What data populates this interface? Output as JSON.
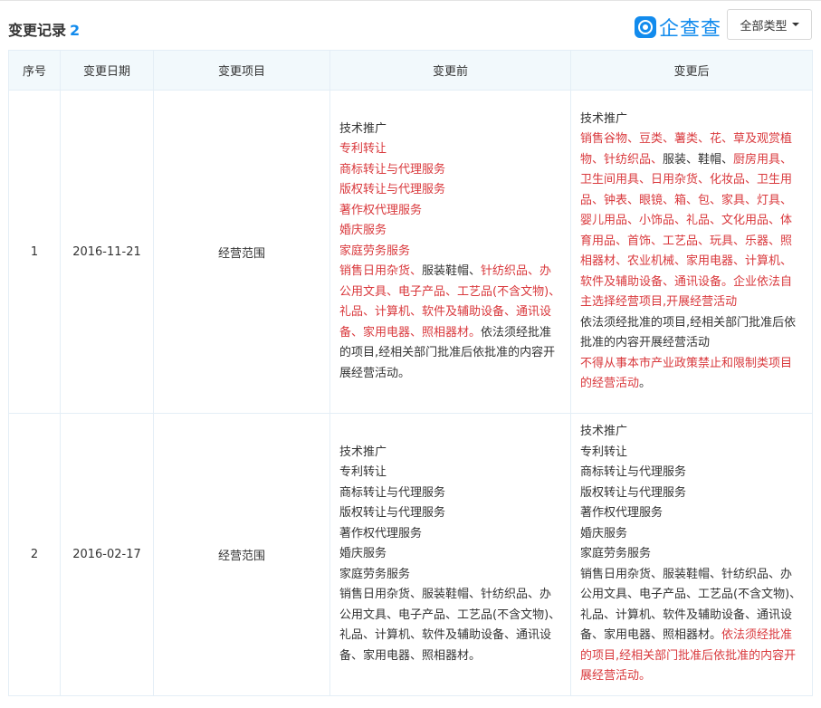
{
  "header": {
    "title": "变更记录",
    "count": "2",
    "logo_text": "企查查",
    "logo_icon": "qichacha-logo-icon",
    "filter_label": "全部类型",
    "filter_icon": "caret-down-icon"
  },
  "columns": [
    "序号",
    "变更日期",
    "变更项目",
    "变更前",
    "变更后"
  ],
  "colors": {
    "accent": "#128bed",
    "changed_text": "#d9383c",
    "header_bg": "#f2f9fc"
  },
  "rows": [
    {
      "index": "1",
      "date": "2016-11-21",
      "item": "经营范围",
      "before": [
        {
          "t": "技术推广",
          "hl": false,
          "br": true
        },
        {
          "t": "专利转让",
          "hl": true,
          "br": true
        },
        {
          "t": "商标转让与代理服务",
          "hl": true,
          "br": true
        },
        {
          "t": "版权转让与代理服务",
          "hl": true,
          "br": true
        },
        {
          "t": "著作权代理服务",
          "hl": true,
          "br": true
        },
        {
          "t": "婚庆服务",
          "hl": true,
          "br": true
        },
        {
          "t": "家庭劳务服务",
          "hl": true,
          "br": true
        },
        {
          "t": "销售日用杂货、",
          "hl": true,
          "br": false
        },
        {
          "t": "服装鞋帽、",
          "hl": false,
          "br": false
        },
        {
          "t": "针纺织品、办公用文具、电子产品、工艺品(不含文物)、礼品、计算机、软件及辅助设备、通讯设备、家用电器、照相器材。",
          "hl": true,
          "br": false
        },
        {
          "t": "依法须经批准的项目,经相关部门批准后依批准的内容开展经营活动。",
          "hl": false,
          "br": false
        }
      ],
      "after": [
        {
          "t": "技术推广",
          "hl": false,
          "br": true
        },
        {
          "t": "销售谷物、豆类、薯类、花、草及观赏植物、针纺织品、",
          "hl": true,
          "br": false
        },
        {
          "t": "服装、鞋帽、",
          "hl": false,
          "br": false
        },
        {
          "t": "厨房用具、卫生间用具、日用杂货、化妆品、卫生用品、钟表、眼镜、箱、包、家具、灯具、婴儿用品、小饰品、礼品、文化用品、体育用品、首饰、工艺品、玩具、乐器、照相器材、农业机械、家用电器、计算机、软件及辅助设备、通讯设备。企业依法自主选择经营项目,开展经营活动",
          "hl": true,
          "br": true
        },
        {
          "t": "依法须经批准的项目,经相关部门批准后依批准的内容开展经营活动",
          "hl": false,
          "br": true
        },
        {
          "t": "不得从事本市产业政策禁止和限制类项目的经营活动",
          "hl": true,
          "br": false
        },
        {
          "t": "。",
          "hl": false,
          "br": false
        }
      ]
    },
    {
      "index": "2",
      "date": "2016-02-17",
      "item": "经营范围",
      "before": [
        {
          "t": "技术推广",
          "hl": false,
          "br": true
        },
        {
          "t": "专利转让",
          "hl": false,
          "br": true
        },
        {
          "t": "商标转让与代理服务",
          "hl": false,
          "br": true
        },
        {
          "t": "版权转让与代理服务",
          "hl": false,
          "br": true
        },
        {
          "t": "著作权代理服务",
          "hl": false,
          "br": true
        },
        {
          "t": "婚庆服务",
          "hl": false,
          "br": true
        },
        {
          "t": "家庭劳务服务",
          "hl": false,
          "br": true
        },
        {
          "t": "销售日用杂货、服装鞋帽、针纺织品、办公用文具、电子产品、工艺品(不含文物)、礼品、计算机、软件及辅助设备、通讯设备、家用电器、照相器材。",
          "hl": false,
          "br": false
        }
      ],
      "after": [
        {
          "t": "技术推广",
          "hl": false,
          "br": true
        },
        {
          "t": "专利转让",
          "hl": false,
          "br": true
        },
        {
          "t": "商标转让与代理服务",
          "hl": false,
          "br": true
        },
        {
          "t": "版权转让与代理服务",
          "hl": false,
          "br": true
        },
        {
          "t": "著作权代理服务",
          "hl": false,
          "br": true
        },
        {
          "t": "婚庆服务",
          "hl": false,
          "br": true
        },
        {
          "t": "家庭劳务服务",
          "hl": false,
          "br": true
        },
        {
          "t": "销售日用杂货、服装鞋帽、针纺织品、办公用文具、电子产品、工艺品(不含文物)、礼品、计算机、软件及辅助设备、通讯设备、家用电器、照相器材。",
          "hl": false,
          "br": false
        },
        {
          "t": "依法须经批准的项目,经相关部门批准后依批准的内容开展经营活动。",
          "hl": true,
          "br": false
        }
      ]
    }
  ]
}
